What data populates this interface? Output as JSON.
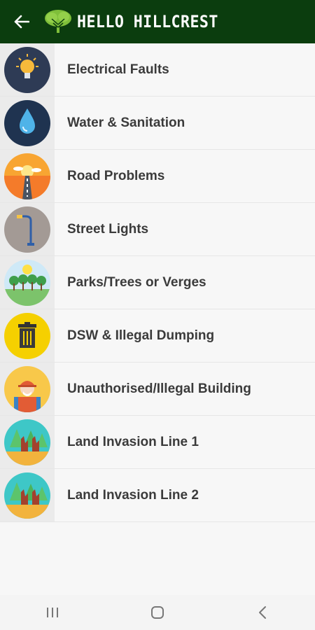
{
  "header": {
    "title": "HELLO HILLCREST",
    "colors": {
      "bar": "#0b3d0e",
      "title": "#ffffff"
    }
  },
  "categories": [
    {
      "label": "Electrical Faults",
      "icon": "lightbulb-icon"
    },
    {
      "label": "Water & Sanitation",
      "icon": "water-drop-icon"
    },
    {
      "label": "Road Problems",
      "icon": "road-icon"
    },
    {
      "label": "Street Lights",
      "icon": "street-light-icon"
    },
    {
      "label": "Parks/Trees or Verges",
      "icon": "park-trees-icon"
    },
    {
      "label": "DSW & Illegal Dumping",
      "icon": "trash-bin-icon"
    },
    {
      "label": "Unauthorised/Illegal Building",
      "icon": "construction-worker-icon"
    },
    {
      "label": "Land Invasion Line 1",
      "icon": "land-invasion-icon"
    },
    {
      "label": "Land Invasion Line 2",
      "icon": "land-invasion-icon"
    }
  ],
  "navbar": {
    "items": [
      "recent-apps-icon",
      "home-icon",
      "back-icon"
    ]
  }
}
